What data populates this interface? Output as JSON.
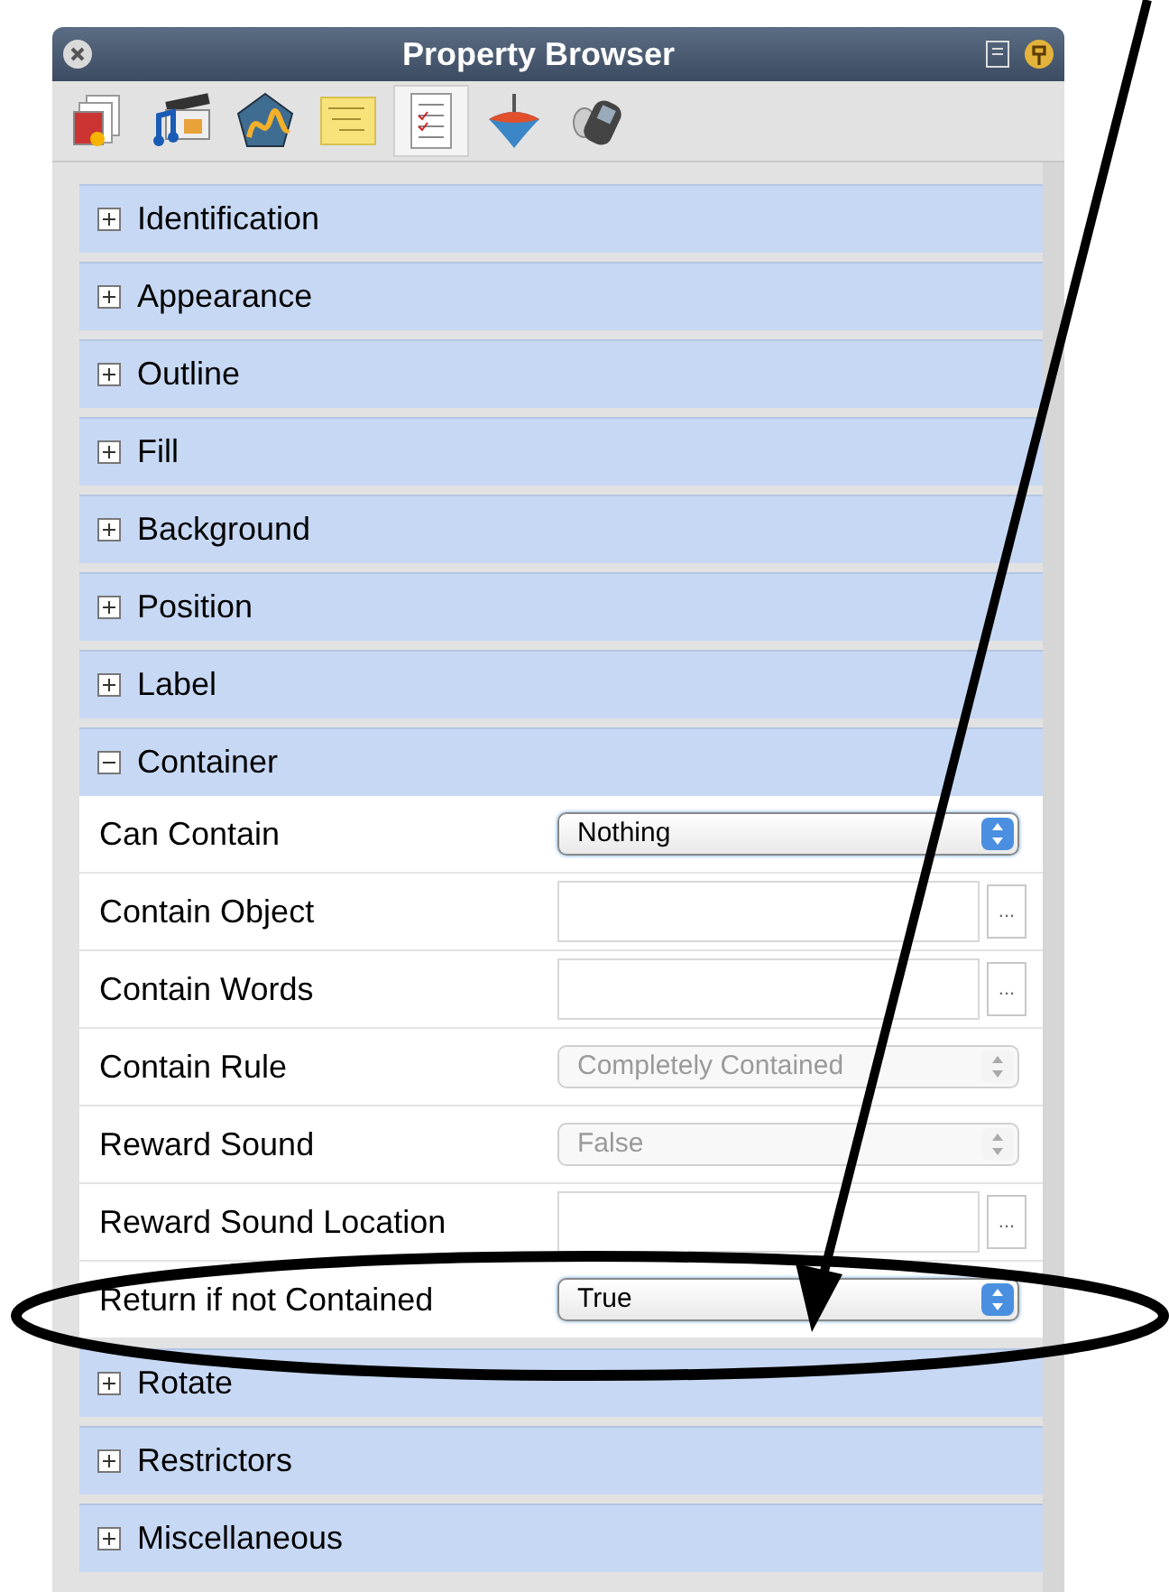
{
  "window": {
    "title": "Property Browser"
  },
  "toolbar": [
    {
      "selected": false
    },
    {
      "selected": false
    },
    {
      "selected": false
    },
    {
      "selected": false
    },
    {
      "selected": true
    },
    {
      "selected": false
    },
    {
      "selected": false
    }
  ],
  "sections": [
    {
      "label": "Identification",
      "expanded": false
    },
    {
      "label": "Appearance",
      "expanded": false
    },
    {
      "label": "Outline",
      "expanded": false
    },
    {
      "label": "Fill",
      "expanded": false
    },
    {
      "label": "Background",
      "expanded": false
    },
    {
      "label": "Position",
      "expanded": false
    },
    {
      "label": "Label",
      "expanded": false
    },
    {
      "label": "Container",
      "expanded": true,
      "properties": [
        {
          "label": "Can Contain",
          "kind": "popup",
          "value": "Nothing",
          "disabled": false
        },
        {
          "label": "Contain Object",
          "kind": "browse"
        },
        {
          "label": "Contain Words",
          "kind": "browse"
        },
        {
          "label": "Contain Rule",
          "kind": "popup",
          "value": "Completely Contained",
          "disabled": true
        },
        {
          "label": "Reward Sound",
          "kind": "popup",
          "value": "False",
          "disabled": true
        },
        {
          "label": "Reward Sound Location",
          "kind": "browse"
        },
        {
          "label": "Return if not Contained",
          "kind": "popup",
          "value": "True",
          "disabled": false
        }
      ]
    },
    {
      "label": "Rotate",
      "expanded": false
    },
    {
      "label": "Restrictors",
      "expanded": false
    },
    {
      "label": "Miscellaneous",
      "expanded": false
    }
  ],
  "browse_button": "..."
}
